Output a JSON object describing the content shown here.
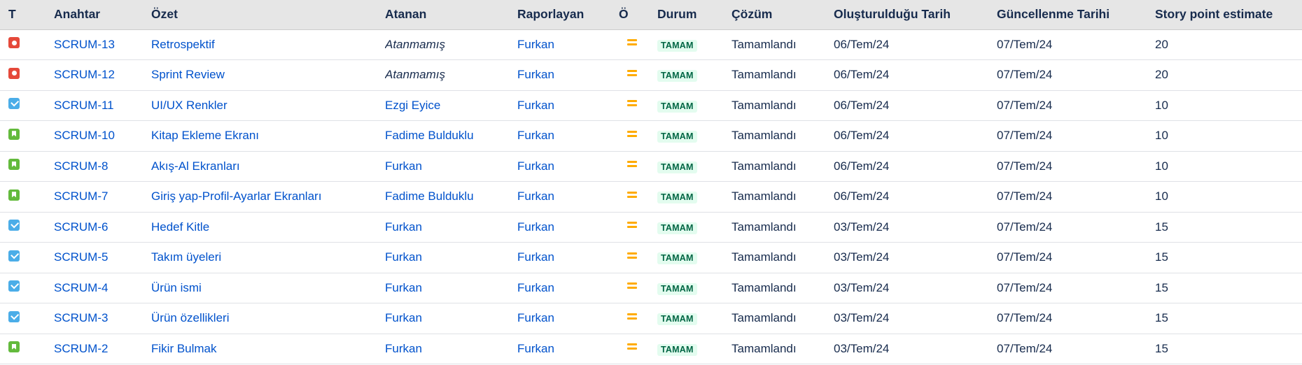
{
  "columns": {
    "type": "T",
    "key": "Anahtar",
    "summary": "Özet",
    "assignee": "Atanan",
    "reporter": "Raporlayan",
    "priority": "Ö",
    "status": "Durum",
    "resolution": "Çözüm",
    "created": "Oluşturulduğu Tarih",
    "updated": "Güncellenme Tarihi",
    "story_points": "Story point estimate"
  },
  "colors": {
    "link": "#0052cc",
    "header_bg": "#e6e6e6",
    "bug_icon": "#e5493a",
    "task_icon": "#4bade8",
    "story_icon": "#63ba3c",
    "priority_medium": "#ffab00",
    "status_done_bg": "#e3fcef",
    "status_done_text": "#006644"
  },
  "rows": [
    {
      "type_icon": "bug-icon",
      "key": "SCRUM-13",
      "summary": "Retrospektif",
      "assignee": "Atanmamış",
      "assignee_unassigned": true,
      "reporter": "Furkan",
      "priority_icon": "priority-medium-icon",
      "status": "TAMAM",
      "resolution": "Tamamlandı",
      "created": "06/Tem/24",
      "updated": "07/Tem/24",
      "story_points": "20"
    },
    {
      "type_icon": "bug-icon",
      "key": "SCRUM-12",
      "summary": "Sprint Review",
      "assignee": "Atanmamış",
      "assignee_unassigned": true,
      "reporter": "Furkan",
      "priority_icon": "priority-medium-icon",
      "status": "TAMAM",
      "resolution": "Tamamlandı",
      "created": "06/Tem/24",
      "updated": "07/Tem/24",
      "story_points": "20"
    },
    {
      "type_icon": "task-icon",
      "key": "SCRUM-11",
      "summary": "UI/UX Renkler",
      "assignee": "Ezgi Eyice",
      "assignee_unassigned": false,
      "reporter": "Furkan",
      "priority_icon": "priority-medium-icon",
      "status": "TAMAM",
      "resolution": "Tamamlandı",
      "created": "06/Tem/24",
      "updated": "07/Tem/24",
      "story_points": "10"
    },
    {
      "type_icon": "story-icon",
      "key": "SCRUM-10",
      "summary": "Kitap Ekleme Ekranı",
      "assignee": "Fadime Bulduklu",
      "assignee_unassigned": false,
      "reporter": "Furkan",
      "priority_icon": "priority-medium-icon",
      "status": "TAMAM",
      "resolution": "Tamamlandı",
      "created": "06/Tem/24",
      "updated": "07/Tem/24",
      "story_points": "10"
    },
    {
      "type_icon": "story-icon",
      "key": "SCRUM-8",
      "summary": "Akış-Al Ekranları",
      "assignee": "Furkan",
      "assignee_unassigned": false,
      "reporter": "Furkan",
      "priority_icon": "priority-medium-icon",
      "status": "TAMAM",
      "resolution": "Tamamlandı",
      "created": "06/Tem/24",
      "updated": "07/Tem/24",
      "story_points": "10"
    },
    {
      "type_icon": "story-icon",
      "key": "SCRUM-7",
      "summary": "Giriş yap-Profil-Ayarlar Ekranları",
      "assignee": "Fadime Bulduklu",
      "assignee_unassigned": false,
      "reporter": "Furkan",
      "priority_icon": "priority-medium-icon",
      "status": "TAMAM",
      "resolution": "Tamamlandı",
      "created": "06/Tem/24",
      "updated": "07/Tem/24",
      "story_points": "10"
    },
    {
      "type_icon": "task-icon",
      "key": "SCRUM-6",
      "summary": "Hedef Kitle",
      "assignee": "Furkan",
      "assignee_unassigned": false,
      "reporter": "Furkan",
      "priority_icon": "priority-medium-icon",
      "status": "TAMAM",
      "resolution": "Tamamlandı",
      "created": "03/Tem/24",
      "updated": "07/Tem/24",
      "story_points": "15"
    },
    {
      "type_icon": "task-icon",
      "key": "SCRUM-5",
      "summary": "Takım üyeleri",
      "assignee": "Furkan",
      "assignee_unassigned": false,
      "reporter": "Furkan",
      "priority_icon": "priority-medium-icon",
      "status": "TAMAM",
      "resolution": "Tamamlandı",
      "created": "03/Tem/24",
      "updated": "07/Tem/24",
      "story_points": "15"
    },
    {
      "type_icon": "task-icon",
      "key": "SCRUM-4",
      "summary": "Ürün ismi",
      "assignee": "Furkan",
      "assignee_unassigned": false,
      "reporter": "Furkan",
      "priority_icon": "priority-medium-icon",
      "status": "TAMAM",
      "resolution": "Tamamlandı",
      "created": "03/Tem/24",
      "updated": "07/Tem/24",
      "story_points": "15"
    },
    {
      "type_icon": "task-icon",
      "key": "SCRUM-3",
      "summary": "Ürün özellikleri",
      "assignee": "Furkan",
      "assignee_unassigned": false,
      "reporter": "Furkan",
      "priority_icon": "priority-medium-icon",
      "status": "TAMAM",
      "resolution": "Tamamlandı",
      "created": "03/Tem/24",
      "updated": "07/Tem/24",
      "story_points": "15"
    },
    {
      "type_icon": "story-icon",
      "key": "SCRUM-2",
      "summary": "Fikir Bulmak",
      "assignee": "Furkan",
      "assignee_unassigned": false,
      "reporter": "Furkan",
      "priority_icon": "priority-medium-icon",
      "status": "TAMAM",
      "resolution": "Tamamlandı",
      "created": "03/Tem/24",
      "updated": "07/Tem/24",
      "story_points": "15"
    }
  ]
}
